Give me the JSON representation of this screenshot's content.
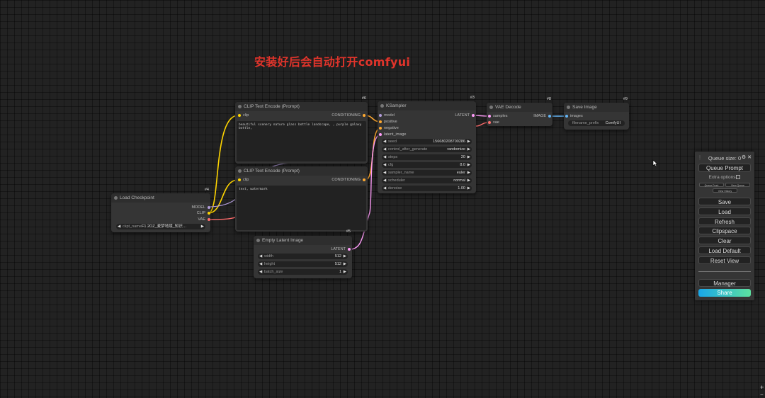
{
  "annotation": "安装好后会自动打开comfyui",
  "colors": {
    "clip": "#ffd500",
    "conditioning": "#ffa931",
    "model": "#b39ddb",
    "vae": "#ff6e6e",
    "latent": "#ff9cf9",
    "image": "#64b5f6",
    "share_start": "#19a7e8",
    "share_end": "#5ce0a0"
  },
  "nodes": {
    "checkpoint": {
      "id": "#4",
      "title": "Load Checkpoint",
      "outputs": [
        "MODEL",
        "CLIP",
        "VAE"
      ],
      "widget": {
        "name": "ckpt_name",
        "value": "F1 2OZ_麦梦地境_知识…"
      }
    },
    "clip_pos": {
      "id": "#6",
      "title": "CLIP Text Encode (Prompt)",
      "input": "clip",
      "output": "CONDITIONING",
      "text": "beautiful scenery nature glass bottle landscape, , purple galaxy bottle,"
    },
    "clip_neg": {
      "id": "#7",
      "title": "CLIP Text Encode (Prompt)",
      "input": "clip",
      "output": "CONDITIONING",
      "text": "text, watermark"
    },
    "latent": {
      "id": "#5",
      "title": "Empty Latent Image",
      "output": "LATENT",
      "widgets": [
        {
          "name": "width",
          "value": "512"
        },
        {
          "name": "height",
          "value": "512"
        },
        {
          "name": "batch_size",
          "value": "1"
        }
      ]
    },
    "ksampler": {
      "id": "#3",
      "title": "KSampler",
      "inputs": [
        "model",
        "positive",
        "negative",
        "latent_image"
      ],
      "output": "LATENT",
      "widgets": [
        {
          "name": "seed",
          "value": "156680208700286"
        },
        {
          "name": "control_after_generate",
          "value": "randomize"
        },
        {
          "name": "steps",
          "value": "20"
        },
        {
          "name": "cfg",
          "value": "8.0"
        },
        {
          "name": "sampler_name",
          "value": "euler"
        },
        {
          "name": "scheduler",
          "value": "normal"
        },
        {
          "name": "denoise",
          "value": "1.00"
        }
      ]
    },
    "vae_decode": {
      "id": "#8",
      "title": "VAE Decode",
      "inputs": [
        "samples",
        "vae"
      ],
      "output": "IMAGE"
    },
    "save_image": {
      "id": "#9",
      "title": "Save Image",
      "input": "images",
      "widget": {
        "name": "filename_prefix",
        "value": "ComfyUI"
      }
    }
  },
  "menu": {
    "queue_size": "Queue size: 0",
    "queue_prompt": "Queue Prompt",
    "extra_options": "Extra options",
    "queue_front": "Queue Front",
    "view_queue": "View Queue",
    "view_history": "View History",
    "save": "Save",
    "load": "Load",
    "refresh": "Refresh",
    "clipspace": "Clipspace",
    "clear": "Clear",
    "load_default": "Load Default",
    "reset_view": "Reset View",
    "manager": "Manager",
    "share": "Share"
  }
}
